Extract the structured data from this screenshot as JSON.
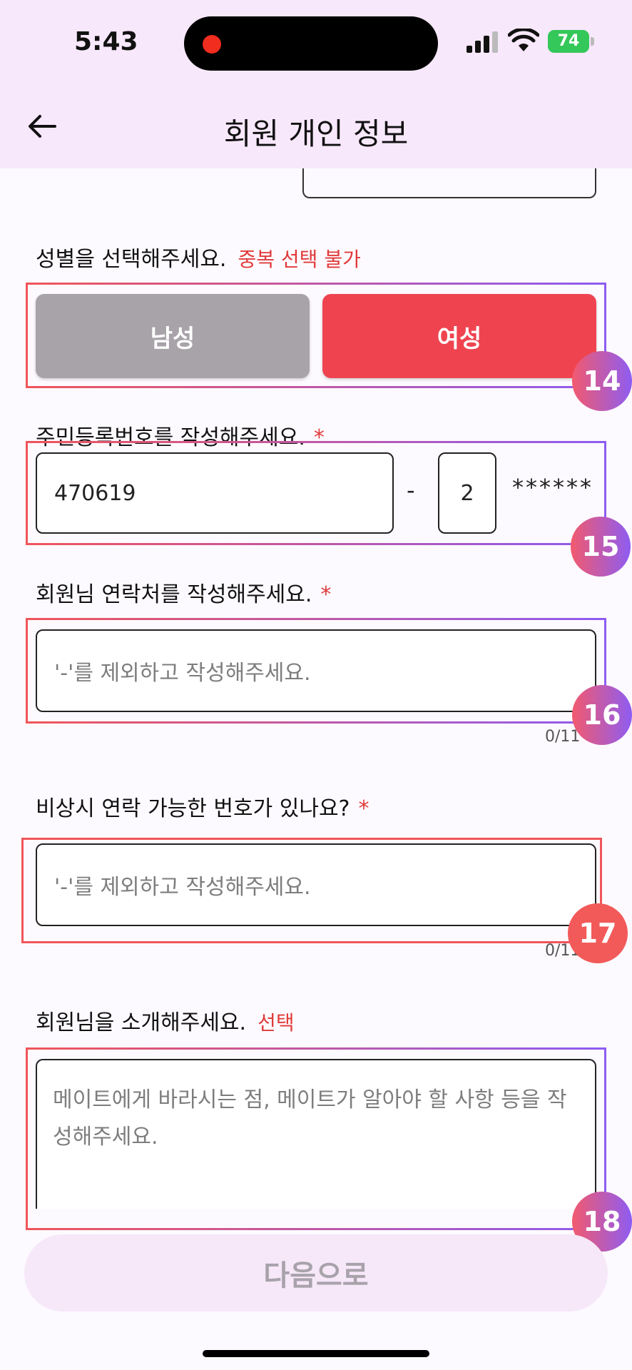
{
  "status_bar": {
    "time": "5:43",
    "battery": "74"
  },
  "header": {
    "title": "회원 개인 정보"
  },
  "gender": {
    "label": "성별을 선택해주세요.",
    "note": "중복 선택 불가",
    "options": [
      "남성",
      "여성"
    ],
    "selected": "여성"
  },
  "resident_number": {
    "label": "주민등록번호를 작성해주세요.",
    "required_mark": "*",
    "front_value": "470619",
    "dash": "-",
    "back_first_digit": "2",
    "masked": "******"
  },
  "contact": {
    "label": "회원님 연락처를 작성해주세요.",
    "required_mark": "*",
    "placeholder": "'-'를 제외하고 작성해주세요.",
    "counter": "0/11"
  },
  "emergency": {
    "label": "비상시 연락 가능한 번호가 있나요?",
    "required_mark": "*",
    "placeholder": "'-'를 제외하고 작성해주세요.",
    "counter": "0/11"
  },
  "introduction": {
    "label": "회원님을 소개해주세요.",
    "note": "선택",
    "placeholder": "메이트에게 바라시는 점, 메이트가 알아야 할 사항 등을 작성해주세요."
  },
  "annotations": [
    "14",
    "15",
    "16",
    "17",
    "18"
  ],
  "next_button": {
    "label": "다음으로"
  },
  "colors": {
    "accent_red": "#ef4450",
    "unselected_gray": "#a7a3a8",
    "header_bg": "#f8e8fb"
  }
}
